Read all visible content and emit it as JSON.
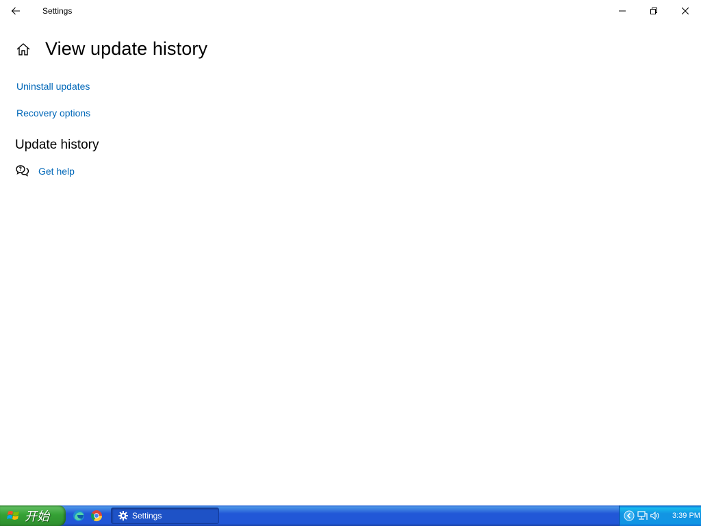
{
  "window": {
    "title": "Settings",
    "icons": {
      "back": "back-arrow-icon",
      "minimize": "minimize-icon",
      "restore": "restore-icon",
      "close": "close-icon"
    }
  },
  "page": {
    "title": "View update history",
    "home_icon": "home-icon",
    "links": {
      "uninstall": "Uninstall updates",
      "recovery": "Recovery options"
    },
    "section_title": "Update history",
    "help": {
      "icon": "chat-help-icon",
      "label": "Get help"
    }
  },
  "taskbar": {
    "start_label": "开始",
    "quick_launch": [
      "edge-icon",
      "chrome-icon"
    ],
    "tasks": [
      {
        "label": "Settings",
        "icon": "gear-icon"
      }
    ],
    "tray_icons": [
      "chevron-left-icon",
      "network-icon",
      "volume-icon"
    ],
    "clock": "3:39 PM"
  },
  "colors": {
    "link": "#0067b8",
    "taskbar_blue": "#2157d7",
    "start_green": "#35a135",
    "tray_blue": "#1095e4"
  }
}
